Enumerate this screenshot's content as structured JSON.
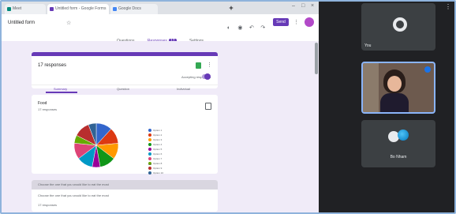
{
  "browser": {
    "tabs": [
      {
        "label": "Meet",
        "favicon_color": "#00897b"
      },
      {
        "label": "Untitled form - Google Forms",
        "favicon_color": "#673ab7"
      },
      {
        "label": "Google Docs",
        "favicon_color": "#4285f4"
      }
    ],
    "new_tab": "+"
  },
  "form": {
    "title": "Untitled form",
    "send_label": "Send",
    "tabs": [
      "Questions",
      "Responses",
      "Settings"
    ],
    "responses_count": "17",
    "summary": {
      "responses_title": "17 responses",
      "accepting_label": "Accepting responses",
      "subtabs": [
        "Summary",
        "Question",
        "Individual"
      ]
    },
    "question": {
      "title": "Food",
      "count": "17 responses",
      "legend_page": "1/2"
    },
    "next_card": {
      "header": "Choose the one that you would like to eat the most",
      "text": "Choose the one that you would like to eat the most",
      "small": "17 responses"
    }
  },
  "chart_data": {
    "type": "pie",
    "categories": [
      "Option 1",
      "Option 2",
      "Option 3",
      "Option 4",
      "Option 5",
      "Option 6",
      "Option 7",
      "Option 8",
      "Option 9",
      "Option 10"
    ],
    "values": [
      11.8,
      11.8,
      11.8,
      11.8,
      5.9,
      11.8,
      11.8,
      5.9,
      11.8,
      5.8
    ],
    "colors": [
      "#3366cc",
      "#dc3912",
      "#ff9900",
      "#109618",
      "#990099",
      "#0099c6",
      "#dd4477",
      "#66aa00",
      "#b82e2e",
      "#316395"
    ]
  },
  "meet": {
    "participants": [
      {
        "name": "You",
        "tile": "avatar"
      },
      {
        "name": "",
        "tile": "video"
      },
      {
        "name": "Bo Nham",
        "tile": "avatar"
      }
    ],
    "more_icon": "more-vert-icon"
  },
  "colors": {
    "accent": "#673ab7",
    "frame": "#8fb3dc",
    "meet_bg": "#202124"
  }
}
